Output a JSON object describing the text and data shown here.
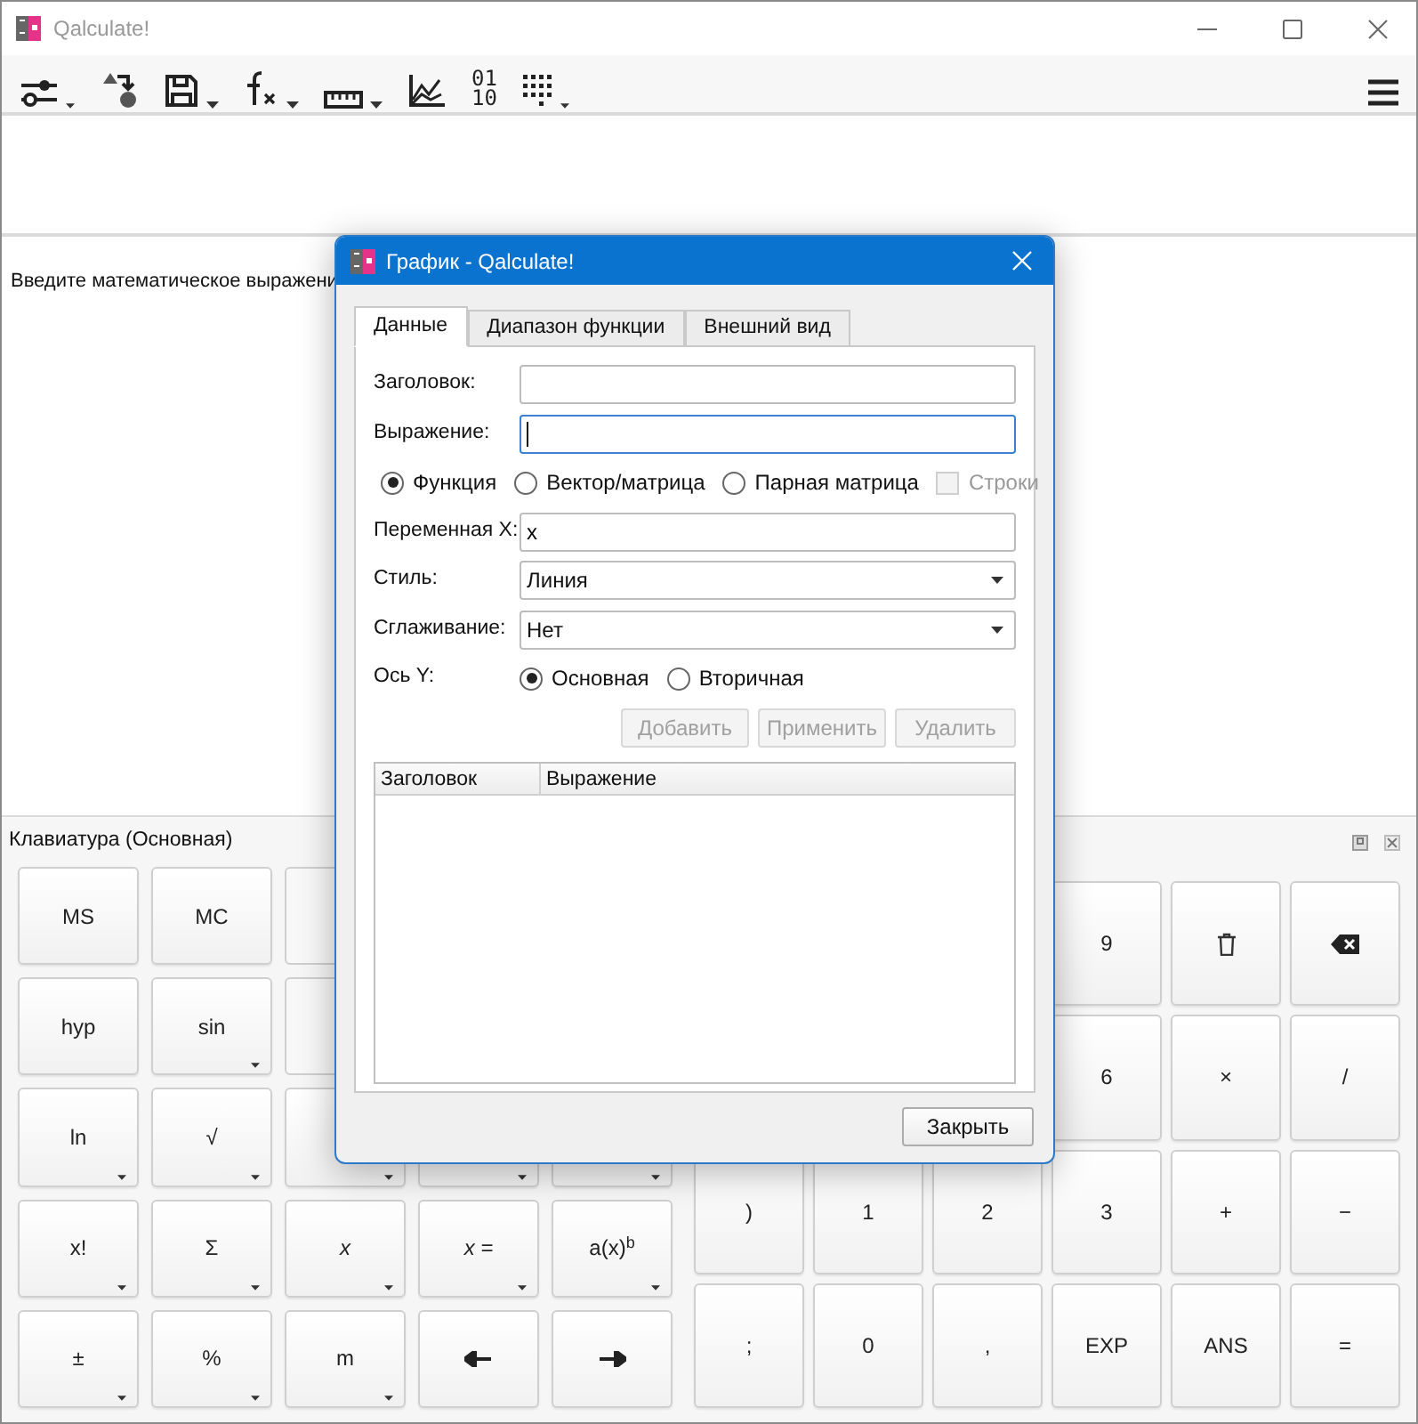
{
  "window": {
    "title": "Qalculate!"
  },
  "toolbar": {
    "items": [
      {
        "kind": "options",
        "menu": true
      },
      {
        "kind": "convert",
        "menu": false
      },
      {
        "kind": "save",
        "menu": true
      },
      {
        "kind": "functions",
        "menu": true
      },
      {
        "kind": "units",
        "menu": true
      },
      {
        "kind": "plot",
        "menu": false
      },
      {
        "kind": "bases",
        "menu": false,
        "text": [
          "01",
          "10"
        ]
      },
      {
        "kind": "keypad",
        "menu": true
      }
    ]
  },
  "history": {
    "hint": "Введите математическое выражени"
  },
  "keypad": {
    "title": "Клавиатура (Основная)",
    "left": [
      [
        {
          "label": "MS",
          "menu": false
        },
        {
          "label": "MC",
          "menu": false
        }
      ],
      [
        {
          "label": "hyp",
          "menu": false
        },
        {
          "label": "sin",
          "menu": true
        }
      ],
      [
        {
          "label": "ln",
          "menu": true
        },
        {
          "label": "√",
          "menu": true
        },
        {
          "menu": true
        },
        {
          "menu": true
        },
        {
          "menu": true
        }
      ],
      [
        {
          "label": "x!",
          "menu": true
        },
        {
          "label": "Σ",
          "menu": true
        },
        {
          "label": "x",
          "italic": true,
          "menu": true
        },
        {
          "label": "x =",
          "italic": true,
          "menu": true
        },
        {
          "label": "a(x)$^{b}$",
          "menu": true
        }
      ],
      [
        {
          "label": "±",
          "menu": true
        },
        {
          "label": "%",
          "menu": true
        },
        {
          "label": "m",
          "menu": true
        },
        {
          "kind": "left",
          "menu": false
        },
        {
          "kind": "right",
          "menu": false
        }
      ]
    ],
    "right": [
      [
        {
          "label": "9"
        },
        {
          "kind": "clear"
        },
        {
          "kind": "backspace"
        }
      ],
      [
        {
          "label": "6"
        },
        {
          "label": "×"
        },
        {
          "label": "/"
        }
      ],
      [
        {
          "label": ")"
        },
        {
          "label": "1"
        },
        {
          "label": "2"
        },
        {
          "label": "3"
        },
        {
          "label": "+"
        },
        {
          "label": "−"
        }
      ],
      [
        {
          "label": ";"
        },
        {
          "label": "0"
        },
        {
          "label": ","
        },
        {
          "label": "EXP"
        },
        {
          "label": "ANS"
        },
        {
          "label": "="
        }
      ]
    ]
  },
  "dialog": {
    "title": "График - Qalculate!",
    "tabs": [
      {
        "label": "Данные",
        "selected": true
      },
      {
        "label": "Диапазон функции",
        "selected": false
      },
      {
        "label": "Внешний вид",
        "selected": false
      }
    ],
    "title_field": {
      "label": "Заголовок:",
      "focused": false
    },
    "expression_field": {
      "label": "Выражение:",
      "focused": true
    },
    "data_type": [
      {
        "label": "Функция",
        "selected": true
      },
      {
        "label": "Вектор/матрица",
        "selected": false
      },
      {
        "label": "Парная матрица",
        "selected": false
      }
    ],
    "rows_checkbox": {
      "label": "Строки",
      "checked": false,
      "disabled": true
    },
    "variable": {
      "label": "Переменная X:",
      "value": "x"
    },
    "style": {
      "label": "Стиль:",
      "value": "Линия"
    },
    "smoothing": {
      "label": "Сглаживание:",
      "value": "Нет"
    },
    "axis": {
      "label": "Ось Y:",
      "options": [
        {
          "label": "Основная",
          "selected": true
        },
        {
          "label": "Вторичная",
          "selected": false
        }
      ]
    },
    "actions": [
      {
        "label": "Добавить",
        "disabled": true
      },
      {
        "label": "Применить",
        "disabled": true
      },
      {
        "label": "Удалить",
        "disabled": true
      }
    ],
    "table": {
      "columns": [
        "Заголовок",
        "Выражение"
      ]
    },
    "close_button": {
      "label": "Закрыть",
      "disabled": false
    }
  }
}
